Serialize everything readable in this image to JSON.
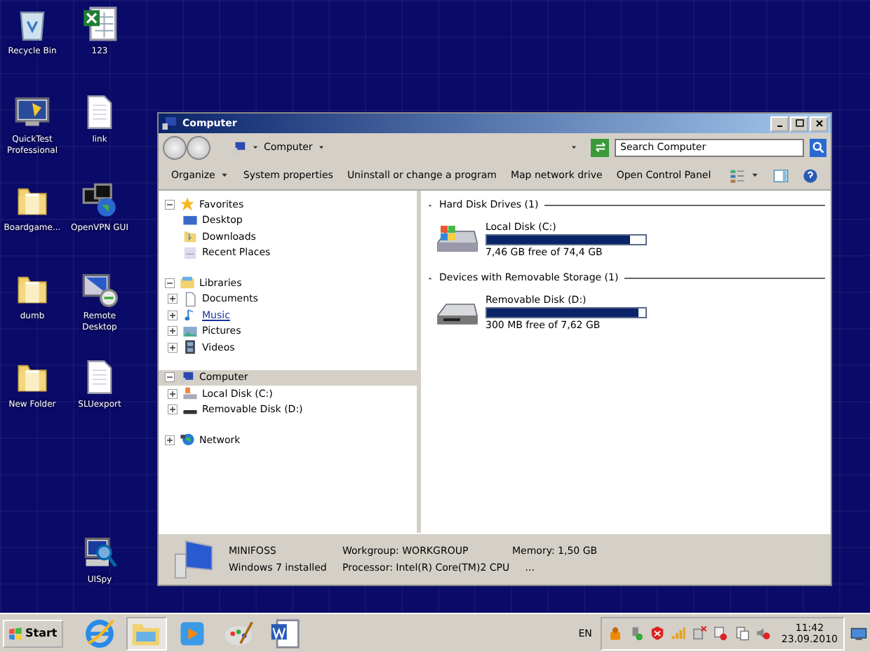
{
  "desktop_icons": [
    {
      "label": "Recycle Bin",
      "kind": "recycle"
    },
    {
      "label": "123",
      "kind": "excel"
    },
    {
      "label": "QuickTest Professional",
      "kind": "monitor-app"
    },
    {
      "label": "link",
      "kind": "document"
    },
    {
      "label": "Boardgame...",
      "kind": "folder"
    },
    {
      "label": "OpenVPN GUI",
      "kind": "network-app"
    },
    {
      "label": "dumb",
      "kind": "folder"
    },
    {
      "label": "Remote Desktop",
      "kind": "remote"
    },
    {
      "label": "New Folder",
      "kind": "folder"
    },
    {
      "label": "SLUexport",
      "kind": "document"
    },
    {
      "label": "UISpy",
      "kind": "spy"
    }
  ],
  "window": {
    "title": "Computer",
    "address": {
      "crumbs": [
        "Computer"
      ]
    },
    "search": {
      "placeholder": "Search Computer"
    },
    "toolbar": [
      {
        "label": "Organize",
        "dropdown": true
      },
      {
        "label": "System properties",
        "dropdown": false
      },
      {
        "label": "Uninstall or change a program",
        "dropdown": false
      },
      {
        "label": "Map network drive",
        "dropdown": false
      },
      {
        "label": "Open Control Panel",
        "dropdown": false
      }
    ],
    "nav": [
      {
        "label": "Favorites",
        "kind": "star",
        "expanded": true,
        "selected": false,
        "hovered": false,
        "children": [
          {
            "label": "Desktop",
            "kind": "desktop",
            "selected": false,
            "hovered": false
          },
          {
            "label": "Downloads",
            "kind": "folder",
            "selected": false,
            "hovered": false
          },
          {
            "label": "Recent Places",
            "kind": "recent",
            "selected": false,
            "hovered": false
          }
        ]
      },
      {
        "label": "Libraries",
        "kind": "library",
        "expanded": true,
        "selected": false,
        "hovered": false,
        "children": [
          {
            "label": "Documents",
            "kind": "document",
            "expanded": false,
            "selected": false,
            "hovered": false
          },
          {
            "label": "Music",
            "kind": "music",
            "expanded": false,
            "selected": false,
            "hovered": true
          },
          {
            "label": "Pictures",
            "kind": "picture",
            "expanded": false,
            "selected": false,
            "hovered": false
          },
          {
            "label": "Videos",
            "kind": "video",
            "expanded": false,
            "selected": false,
            "hovered": false
          }
        ]
      },
      {
        "label": "Computer",
        "kind": "computer",
        "expanded": true,
        "selected": true,
        "hovered": false,
        "children": [
          {
            "label": "Local Disk (C:)",
            "kind": "hdd",
            "expanded": false,
            "selected": false,
            "hovered": false
          },
          {
            "label": "Removable Disk (D:)",
            "kind": "usb",
            "expanded": false,
            "selected": false,
            "hovered": false
          }
        ]
      },
      {
        "label": "Network",
        "kind": "network",
        "expanded": false,
        "selected": false,
        "hovered": false
      }
    ],
    "groups": [
      {
        "title": "Hard Disk Drives (1)",
        "drives": [
          {
            "name": "Local Disk (C:)",
            "kind": "hdd",
            "level": 0.9,
            "free": "7,46 GB free of 74,4 GB"
          }
        ]
      },
      {
        "title": "Devices with Removable Storage (1)",
        "drives": [
          {
            "name": "Removable Disk (D:)",
            "kind": "usb",
            "level": 0.96,
            "free": "300 MB free of 7,62 GB"
          }
        ]
      }
    ],
    "details": {
      "name": "MINIFOSS",
      "os": "Windows 7 installed",
      "workgroup": "Workgroup: WORKGROUP",
      "processor": "Processor: Intel(R) Core(TM)2 CPU     ...",
      "memory": "Memory: 1,50 GB"
    }
  },
  "taskbar": {
    "start": "Start",
    "apps": [
      {
        "kind": "browser",
        "selected": false
      },
      {
        "kind": "explorer",
        "selected": true
      },
      {
        "kind": "media",
        "selected": false
      },
      {
        "kind": "paint",
        "selected": false
      },
      {
        "kind": "word",
        "selected": false
      }
    ],
    "language": "EN",
    "time": "11:42",
    "date": "23.09.2010"
  }
}
